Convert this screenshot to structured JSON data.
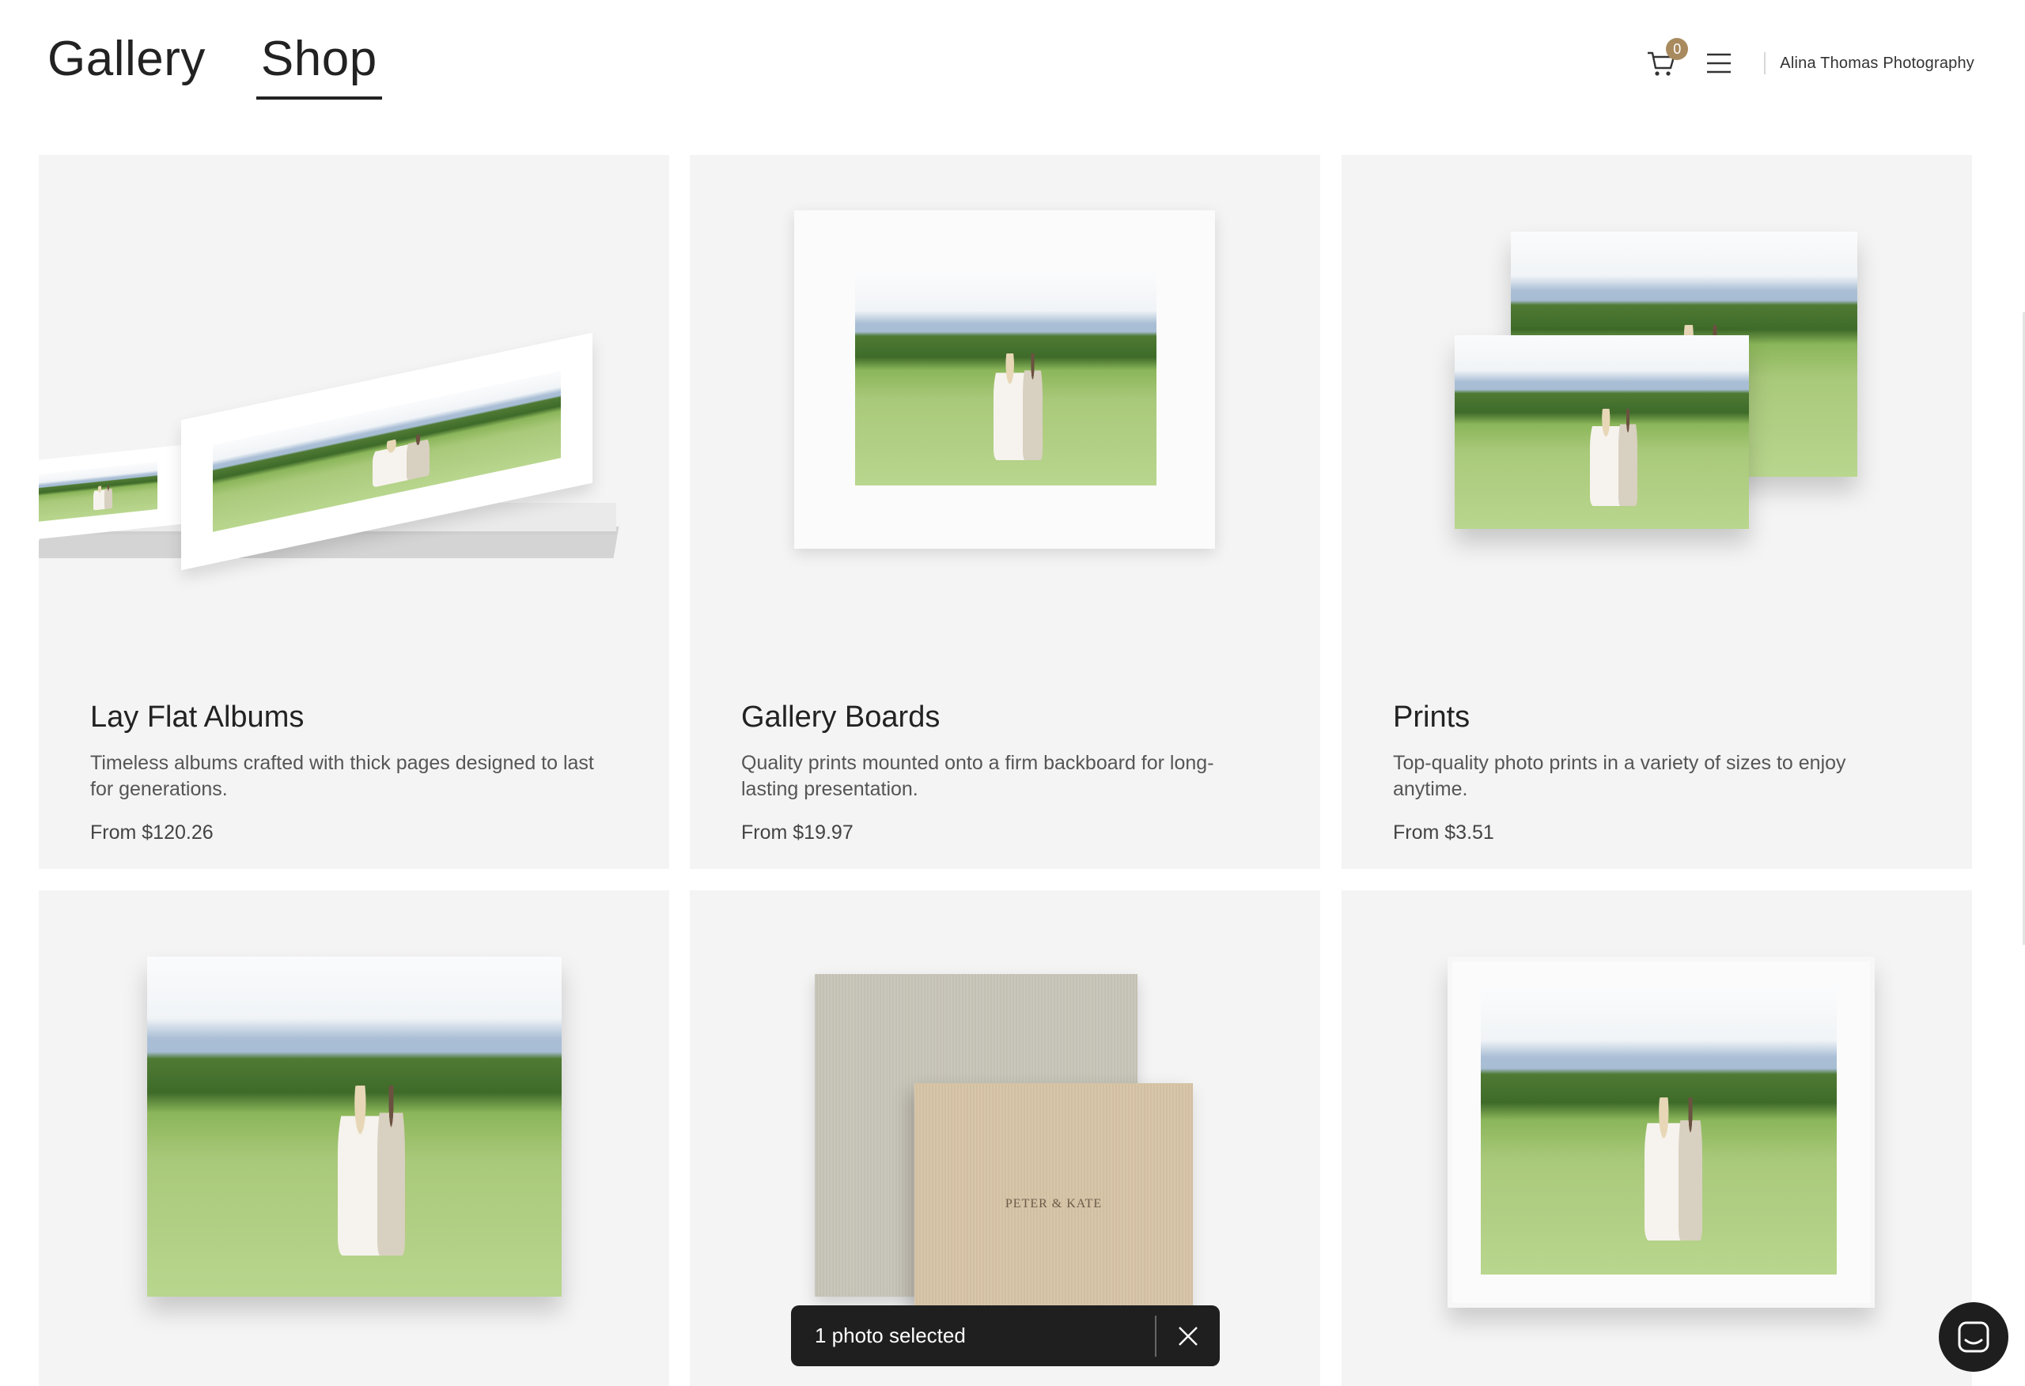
{
  "nav": {
    "tabs": [
      {
        "label": "Gallery",
        "active": false
      },
      {
        "label": "Shop",
        "active": true
      }
    ]
  },
  "header": {
    "cart_icon": "cart-icon",
    "cart_count": "0",
    "menu_icon": "hamburger-menu-icon",
    "brand": "Alina Thomas Photography"
  },
  "products": [
    {
      "title": "Lay Flat Albums",
      "description": "Timeless albums crafted with thick pages designed to last for generations.",
      "price": "From $120.26"
    },
    {
      "title": "Gallery Boards",
      "description": "Quality prints mounted onto a firm backboard for long-lasting presentation.",
      "price": "From $19.97"
    },
    {
      "title": "Prints",
      "description": "Top-quality photo prints in a variety of sizes to enjoy anytime.",
      "price": "From $3.51"
    }
  ],
  "album_cover_text": "PETER & KATE",
  "toast": {
    "text": "1 photo selected",
    "close_icon": "close-icon"
  },
  "chat": {
    "icon": "chat-icon"
  },
  "colors": {
    "card_bg": "#f4f4f4",
    "badge": "#a88a5e",
    "toast_bg": "#1f1f1f"
  }
}
